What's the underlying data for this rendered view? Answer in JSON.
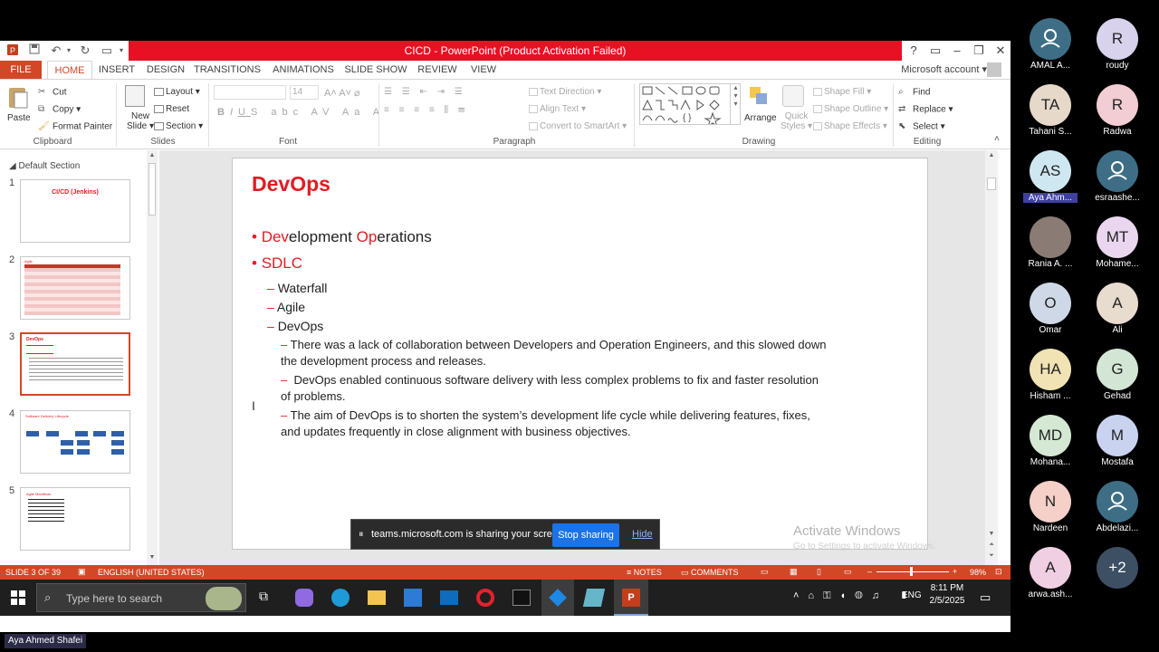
{
  "window": {
    "title": "CICD - PowerPoint (Product Activation Failed)",
    "account": "Microsoft account"
  },
  "tabs": [
    "FILE",
    "HOME",
    "INSERT",
    "DESIGN",
    "TRANSITIONS",
    "ANIMATIONS",
    "SLIDE SHOW",
    "REVIEW",
    "VIEW"
  ],
  "ribbon": {
    "clipboard": {
      "paste": "Paste",
      "cut": "Cut",
      "copy": "Copy",
      "format_painter": "Format Painter",
      "group": "Clipboard"
    },
    "slides": {
      "new_slide": "New",
      "new_slide2": "Slide",
      "layout": "Layout",
      "reset": "Reset",
      "section": "Section",
      "group": "Slides"
    },
    "font": {
      "size": "14",
      "group": "Font"
    },
    "paragraph": {
      "text_direction": "Text Direction",
      "align_text": "Align Text",
      "convert": "Convert to SmartArt",
      "group": "Paragraph"
    },
    "drawing": {
      "arrange": "Arrange",
      "quick_styles": "Quick",
      "quick_styles2": "Styles",
      "shape_fill": "Shape Fill",
      "shape_outline": "Shape Outline",
      "shape_effects": "Shape Effects",
      "group": "Drawing"
    },
    "editing": {
      "find": "Find",
      "replace": "Replace",
      "select": "Select",
      "group": "Editing"
    }
  },
  "thumbnails": {
    "section": "Default Section",
    "items": [
      {
        "num": "1",
        "title": "CI/CD (Jenkins)"
      },
      {
        "num": "2",
        "title": "Agile"
      },
      {
        "num": "3",
        "title": "DevOps"
      },
      {
        "num": "4",
        "title": "Software Delivery Lifecycle"
      },
      {
        "num": "5",
        "title": "Agile Manifesto"
      }
    ]
  },
  "slide": {
    "title": "DevOps",
    "b1_dev": "Dev",
    "b1_elopment": "elopment ",
    "b1_op": "Op",
    "b1_erations": "erations",
    "b2": "SDLC",
    "s1": "Waterfall",
    "s2": "Agile",
    "s3": "DevOps",
    "p1a": "There was a lack of collaboration between Developers and Operation Engineers, and this slowed down",
    "p1b": "the development process and releases.",
    "p2a": "DevOps enabled continuous software delivery with less complex problems to fix and faster resolution",
    "p2b": "of problems.",
    "p3a": "The aim of DevOps is to shorten the system’s development life cycle while delivering features, fixes,",
    "p3b": "and updates frequently in close alignment with business objectives."
  },
  "watermark": {
    "line1": "Activate Windows",
    "line2": "Go to Settings to activate Windows."
  },
  "sharing": {
    "text": "teams.microsoft.com is sharing your screen.",
    "stop": "Stop sharing",
    "hide": "Hide"
  },
  "status": {
    "slide": "SLIDE 3 OF 39",
    "lang": "ENGLISH (UNITED STATES)",
    "notes": "NOTES",
    "comments": "COMMENTS",
    "zoom": "98%"
  },
  "taskbar": {
    "search_placeholder": "Type here to search",
    "lang": "ENG",
    "time": "8:11 PM",
    "date": "2/5/2025"
  },
  "presenter": "Aya Ahmed Shafei",
  "participants": [
    {
      "initials": "",
      "name": "AMAL A...",
      "color": "#3d6e86"
    },
    {
      "initials": "R",
      "name": "roudy",
      "color": "#d9d2ec"
    },
    {
      "initials": "TA",
      "name": "Tahani S...",
      "color": "#e7d9c9"
    },
    {
      "initials": "R",
      "name": "Radwa",
      "color": "#f2cdd3"
    },
    {
      "initials": "AS",
      "name": "Aya Ahm...",
      "color": "#cfe7f1"
    },
    {
      "initials": "",
      "name": "esraashe...",
      "color": "#3d6e86"
    },
    {
      "initials": "",
      "name": "Rania A. ...",
      "color": "#8a7b75"
    },
    {
      "initials": "MT",
      "name": "Mohame...",
      "color": "#ead7ef"
    },
    {
      "initials": "O",
      "name": "Omar",
      "color": "#cfd8e6"
    },
    {
      "initials": "A",
      "name": "Ali",
      "color": "#e8dccf"
    },
    {
      "initials": "HA",
      "name": "Hisham ...",
      "color": "#f1e3b4"
    },
    {
      "initials": "G",
      "name": "Gehad",
      "color": "#d3e6d6"
    },
    {
      "initials": "MD",
      "name": "Mohana...",
      "color": "#d5e8d4"
    },
    {
      "initials": "M",
      "name": "Mostafa",
      "color": "#c9d3f0"
    },
    {
      "initials": "N",
      "name": "Nardeen",
      "color": "#f4d0c8"
    },
    {
      "initials": "",
      "name": "Abdelazi...",
      "color": "#3d6e86"
    },
    {
      "initials": "A",
      "name": "arwa.ash...",
      "color": "#f1cfe2"
    },
    {
      "initials": "+2",
      "name": "",
      "color": "#3d4f63"
    }
  ]
}
